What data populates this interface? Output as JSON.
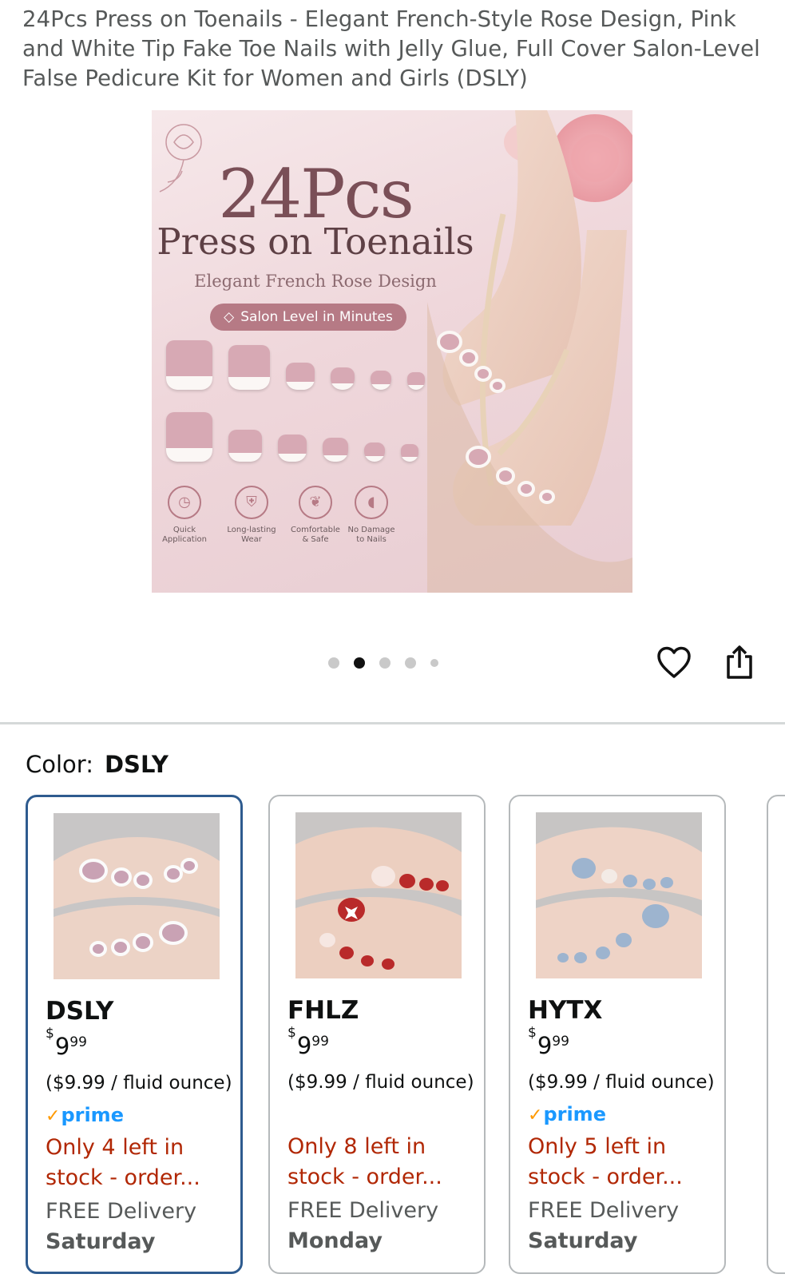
{
  "product": {
    "title": "24Pcs Press on Toenails - Elegant French-Style Rose Design, Pink and White Tip Fake Toe Nails with Jelly Glue, Full Cover Salon-Level False Pedicure Kit for Women and Girls (DSLY)"
  },
  "hero": {
    "headline": "24Pcs",
    "subheadline": "Press on Toenails",
    "tagline": "Elegant French Rose Design",
    "pill": "Salon Level in Minutes",
    "features": [
      {
        "label": "Quick Application",
        "icon": "clock-icon"
      },
      {
        "label": "Long-lasting Wear",
        "icon": "shield-icon"
      },
      {
        "label": "Comfortable & Safe",
        "icon": "leaf-icon"
      },
      {
        "label": "No Damage to Nails",
        "icon": "nail-icon"
      }
    ]
  },
  "carousel": {
    "dots": 5,
    "active_index": 1
  },
  "actions": {
    "wishlist_icon": "heart-icon",
    "share_icon": "share-icon"
  },
  "color_selector": {
    "label": "Color:",
    "selected": "DSLY",
    "options": [
      {
        "name": "DSLY",
        "price_whole": "9",
        "price_fraction": "99",
        "currency": "$",
        "unit_price": "($9.99 / fluid ounce)",
        "prime": "prime",
        "stock": "Only 4 left in stock - order...",
        "delivery": "FREE Delivery",
        "delivery_day": "Saturday",
        "selected": true
      },
      {
        "name": "FHLZ",
        "price_whole": "9",
        "price_fraction": "99",
        "currency": "$",
        "unit_price": "($9.99 / fluid ounce)",
        "prime": "",
        "stock": "Only 8 left in stock - order...",
        "delivery": "FREE Delivery",
        "delivery_day": "Monday",
        "selected": false
      },
      {
        "name": "HYTX",
        "price_whole": "9",
        "price_fraction": "99",
        "currency": "$",
        "unit_price": "($9.99 / fluid ounce)",
        "prime": "prime",
        "stock": "Only 5 left in stock - order...",
        "delivery": "FREE Delivery",
        "delivery_day": "Saturday",
        "selected": false
      }
    ]
  },
  "colors": {
    "stock_red": "#b12704",
    "prime_blue": "#1a98ff",
    "prime_check": "#ff9900",
    "selected_border": "#2e5b8f",
    "hero_accent": "#b67a85"
  }
}
